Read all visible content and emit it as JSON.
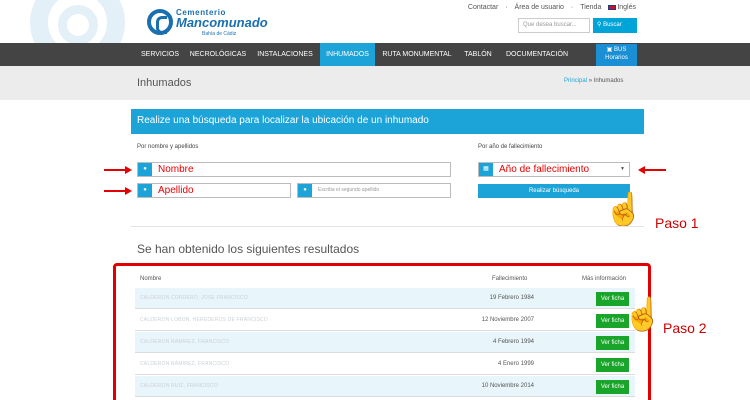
{
  "header": {
    "logo": {
      "top": "Cementerio",
      "main": "Mancomunado",
      "sub": "Bahía de Cádiz"
    },
    "top_links": [
      "Contactar",
      "Área de usuario",
      "Tienda",
      "Inglés"
    ],
    "search_placeholder": "Que desea buscar...",
    "search_button": "Buscar"
  },
  "nav": {
    "items": [
      "SERVICIOS",
      "NECROLÓGICAS",
      "INSTALACIONES",
      "INHUMADOS",
      "RUTA MONUMENTAL",
      "TABLÓN",
      "DOCUMENTACIÓN"
    ],
    "active": "INHUMADOS",
    "bus": {
      "line1": "BUS",
      "line2": "Horarios"
    },
    "active_color": "#1ca4d8"
  },
  "page": {
    "title": "Inhumados",
    "breadcrumb": {
      "home": "Principal",
      "sep": "»",
      "current": "Inhumados"
    }
  },
  "search_form": {
    "banner": "Realize una búsqueda para localizar la ubicación de un inhumado",
    "by_name_label": "Por nombre y apellidos",
    "by_year_label": "Por año de fallecimiento",
    "name_value": "Nombre",
    "surname_value": "Apellido",
    "surname2_placeholder": "Escriba el segundo apellido",
    "year_value": "Año de fallecimiento",
    "submit": "Realizar búsqueda"
  },
  "annotations": {
    "step1": "Paso 1",
    "step2": "Paso 2",
    "color": "#cc0000"
  },
  "results": {
    "title": "Se han obtenido los siguientes resultados",
    "columns": [
      "Nombre",
      "Fallecimiento",
      "Más información"
    ],
    "rows": [
      {
        "name": "CALDERON CORDERO, JOSE FRANCISCO",
        "date": "19 Febrero 1984",
        "action": "Ver ficha"
      },
      {
        "name": "CALDERON LOBON, HEREDEROS DE FRANCISCO",
        "date": "12 Noviembre 2007",
        "action": "Ver ficha"
      },
      {
        "name": "CALDERON RAMIREZ, FRANCISCO",
        "date": "4 Febrero 1994",
        "action": "Ver ficha"
      },
      {
        "name": "CALDERON RAMIREZ, FRANCISCO",
        "date": "4 Enero 1999",
        "action": "Ver ficha"
      },
      {
        "name": "CALDERON RUIZ, FRANCISCO",
        "date": "10 Noviembre 2014",
        "action": "Ver ficha"
      }
    ]
  }
}
